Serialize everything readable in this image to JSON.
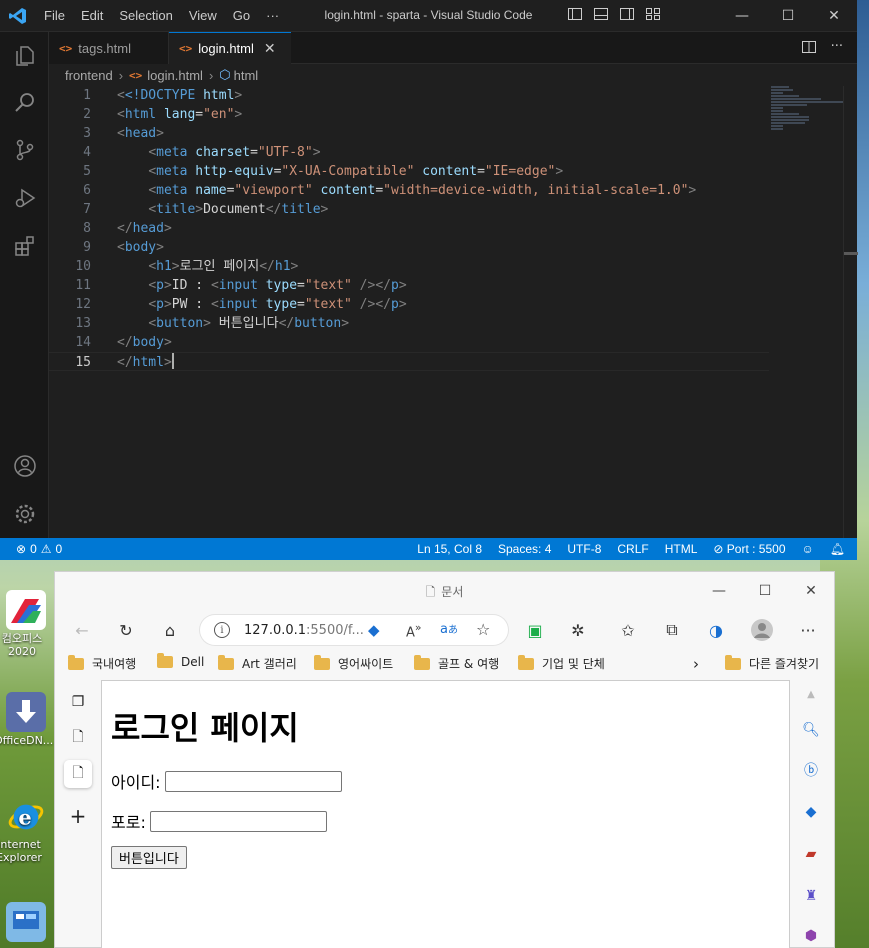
{
  "vscode": {
    "menu": [
      "File",
      "Edit",
      "Selection",
      "View",
      "Go",
      "···"
    ],
    "window_title": "login.html - sparta - Visual Studio Code",
    "tabs": [
      {
        "label": "tags.html"
      },
      {
        "label": "login.html"
      }
    ],
    "breadcrumb": {
      "folder": "frontend",
      "file": "login.html",
      "symbol": "html"
    },
    "code_lines": [
      {
        "n": "1"
      },
      {
        "n": "2"
      },
      {
        "n": "3"
      },
      {
        "n": "4"
      },
      {
        "n": "5"
      },
      {
        "n": "6"
      },
      {
        "n": "7"
      },
      {
        "n": "8"
      },
      {
        "n": "9"
      },
      {
        "n": "10"
      },
      {
        "n": "11"
      },
      {
        "n": "12"
      },
      {
        "n": "13"
      },
      {
        "n": "14"
      },
      {
        "n": "15"
      }
    ],
    "code": {
      "doctype": "<!DOCTYPE",
      "doctype_html": "html",
      "lang_val": "\"en\"",
      "charset_val": "\"UTF-8\"",
      "http_equiv_val": "\"X-UA-Compatible\"",
      "content_edge": "\"IE=edge\"",
      "viewport_val": "\"viewport\"",
      "content_viewport": "\"width=device-width, initial-scale=1.0\"",
      "title_text": "Document",
      "h1_text": "로그인 페이지",
      "id_label": "ID : ",
      "pw_label": "PW : ",
      "type_text": "\"text\"",
      "button_text": " 버튼입니다"
    },
    "status": {
      "problems": "0",
      "warnings": "0",
      "position": "Ln 15, Col 8",
      "spaces": "Spaces: 4",
      "encoding": "UTF-8",
      "eol": "CRLF",
      "language": "HTML",
      "port": "Port : 5500"
    }
  },
  "desktop_icons": [
    {
      "label": "컴오피스 2020"
    },
    {
      "label": "OfficeDN..."
    },
    {
      "label": "Internet Explorer"
    }
  ],
  "edge": {
    "tab_title": "문서",
    "url_host": "127.0.0.1",
    "url_rest": ":5500/f...",
    "favorites": [
      "국내여행",
      "Dell",
      "Art 갤러리",
      "영어싸이트",
      "골프 & 여행",
      "기업 및 단체"
    ],
    "other_favorites": "다른 즐겨찾기",
    "page": {
      "heading": "로그인 페이지",
      "id_label": "아이디:",
      "pw_label": "포로:",
      "button": "버튼입니다"
    }
  },
  "colors": {
    "vscode_accent": "#0078d4",
    "tag": "#569cd6",
    "attr": "#9cdcfe",
    "string": "#ce9178"
  }
}
